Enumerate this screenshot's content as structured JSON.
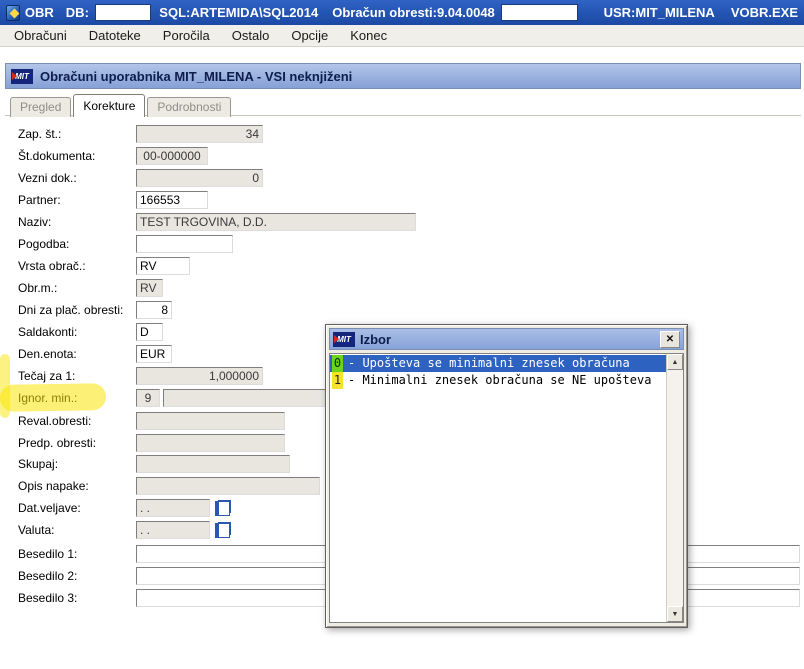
{
  "titlebar": {
    "app": "OBR",
    "db_label": "DB:",
    "sql": "SQL:ARTEMIDA\\SQL2014",
    "obresti": "Obračun obresti:9.04.0048",
    "user": "USR:MIT_MILENA",
    "exe": "VOBR.EXE"
  },
  "menu": {
    "items": [
      "Obračuni",
      "Datoteke",
      "Poročila",
      "Ostalo",
      "Opcije",
      "Konec"
    ]
  },
  "child": {
    "logo": "MIT",
    "title": "Obračuni uporabnika MIT_MILENA - VSI neknjiženi"
  },
  "tabs": [
    {
      "label": "Pregled",
      "state": "disabled"
    },
    {
      "label": "Korekture",
      "state": "active"
    },
    {
      "label": "Podrobnosti",
      "state": "disabled"
    }
  ],
  "form": {
    "rows": [
      {
        "label": "Zap. št.:",
        "value": "34"
      },
      {
        "label": "Št.dokumenta:",
        "value": "00-000000"
      },
      {
        "label": "Vezni dok.:",
        "value": "0"
      },
      {
        "label": "Partner:",
        "value": "166553"
      },
      {
        "label": "Naziv:",
        "value": "TEST TRGOVINA, D.D."
      },
      {
        "label": "Pogodba:",
        "value": ""
      },
      {
        "label": "Vrsta obrač.:",
        "value": "RV"
      },
      {
        "label": "Obr.m.:",
        "value": "RV"
      },
      {
        "label": "Dni za plač. obresti:",
        "value": "8"
      },
      {
        "label": "Saldakonti:",
        "value": "D"
      },
      {
        "label": "Den.enota:",
        "value": "EUR"
      },
      {
        "label": "Tečaj za 1:",
        "value": "1,000000"
      },
      {
        "label": "Ignor. min.:",
        "value": "9",
        "extra": ""
      },
      {
        "label": "Reval.obresti:",
        "value": ""
      },
      {
        "label": "Predp. obresti:",
        "value": ""
      },
      {
        "label": "Skupaj:",
        "value": ""
      },
      {
        "label": "Opis napake:",
        "value": ""
      },
      {
        "label": "Dat.veljave:",
        "value": ".  ."
      },
      {
        "label": "Valuta:",
        "value": ".  ."
      },
      {
        "label": "Besedilo 1:",
        "value": ""
      },
      {
        "label": "Besedilo 2:",
        "value": ""
      },
      {
        "label": "Besedilo 3:",
        "value": ""
      }
    ]
  },
  "popup": {
    "logo": "MIT",
    "title": "Izbor",
    "close_glyph": "✕",
    "items": [
      {
        "num": "0",
        "text": "- Upošteva se minimalni znesek obračuna",
        "selected": true
      },
      {
        "num": "1",
        "text": "- Minimalni znesek obračuna se NE upošteva",
        "selected": false
      }
    ],
    "scroll_up_glyph": "▲",
    "scroll_down_glyph": "▼"
  },
  "annotations": {
    "marker_yellow": "#f8e405",
    "marker_green": "#6cd41f",
    "selected_row_blue": "#2e62c0"
  }
}
